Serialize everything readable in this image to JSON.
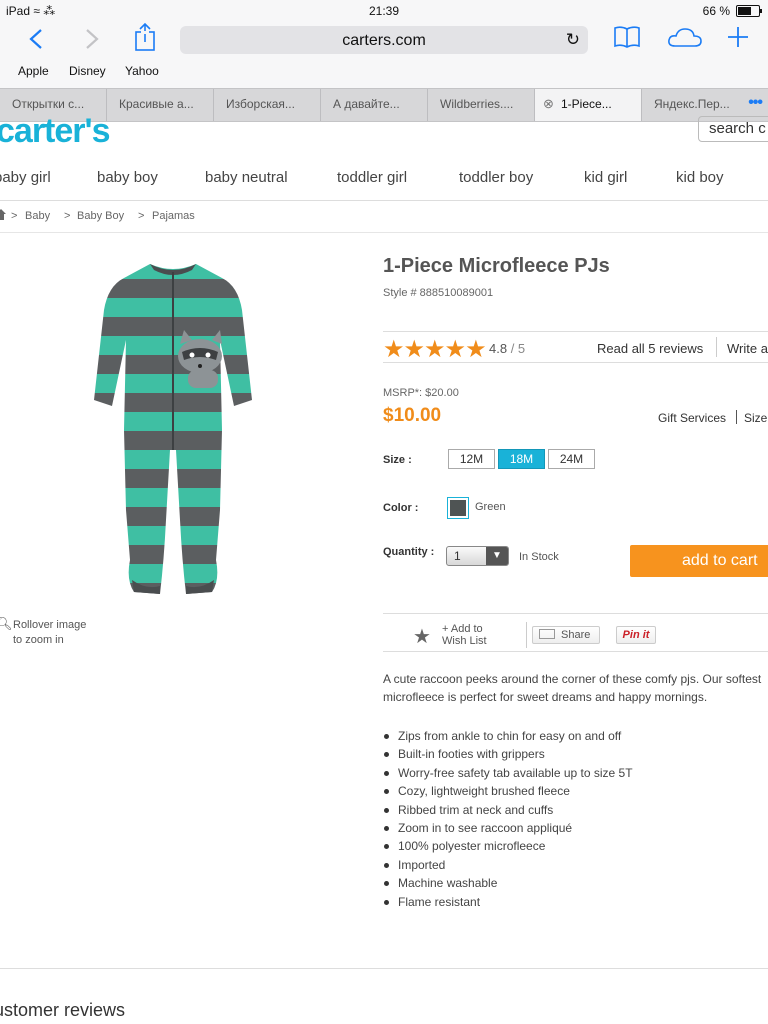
{
  "status": {
    "device": "iPad",
    "time": "21:39",
    "battery": "66 %"
  },
  "browser": {
    "url": "carters.com",
    "favorites": [
      "Apple",
      "Disney",
      "Yahoo"
    ],
    "tabs": [
      "Открытки с...",
      "Красивые а...",
      "Изборская...",
      "А давайте...",
      "Wildberries....",
      "1-Piece...",
      "Яндекс.Пер..."
    ],
    "active_tab_index": 5
  },
  "site": {
    "logo": "carter's",
    "search_placeholder": "search c",
    "nav": [
      "baby girl",
      "baby boy",
      "baby neutral",
      "toddler girl",
      "toddler boy",
      "kid girl",
      "kid boy"
    ],
    "breadcrumb": [
      "Baby",
      "Baby Boy",
      "Pajamas"
    ]
  },
  "product": {
    "title": "1-Piece Microfleece PJs",
    "style": "Style # 888510089001",
    "rating": "4.8",
    "rating_max": "/ 5",
    "stars_filled": 5,
    "read_reviews": "Read all 5 reviews",
    "write_review": "Write a",
    "msrp": "MSRP*: $20.00",
    "price": "$10.00",
    "gift_services": "Gift Services",
    "size_chart": "Size",
    "size_label": "Size :",
    "sizes": [
      "12M",
      "18M",
      "24M"
    ],
    "selected_size": "18M",
    "color_label": "Color :",
    "color_name": "Green",
    "quantity_label": "Quantity :",
    "quantity": "1",
    "stock": "In Stock",
    "add_to_cart": "add to cart",
    "wish_list": [
      "+ Add to",
      "Wish List"
    ],
    "share": "Share",
    "pinit": "Pin it",
    "zoom_hint": [
      "Rollover image",
      "to zoom in"
    ],
    "description": "A cute raccoon peeks around the corner of these comfy pjs. Our softest microfleece is perfect for sweet dreams and happy mornings.",
    "features": [
      "Zips from ankle to chin for easy on and off",
      "Built-in footies with grippers",
      "Worry-free safety tab available up to size 5T",
      "Cozy, lightweight brushed fleece",
      "Ribbed trim at neck and cuffs",
      "Zoom in to see raccoon appliqué",
      "100% polyester microfleece",
      "Imported",
      "Machine washable",
      "Flame resistant"
    ]
  },
  "reviews": {
    "heading": "ustomer reviews"
  },
  "colors": {
    "brand": "#19b2d8",
    "price": "#f08c1a",
    "cart": "#f7931e",
    "stripe_green": "#3fbfa3",
    "stripe_gray": "#5b5e60"
  }
}
